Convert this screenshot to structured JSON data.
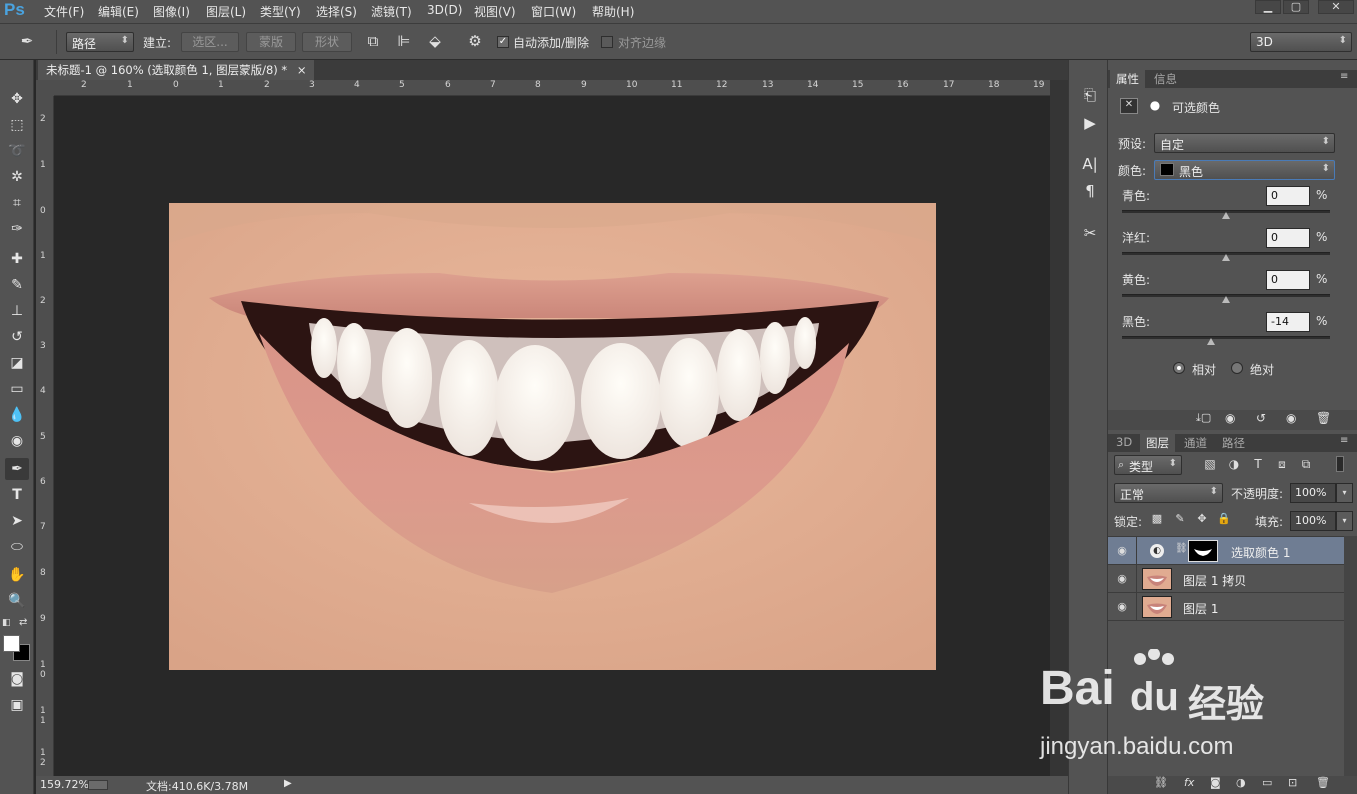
{
  "app": {
    "logo": "Ps"
  },
  "menu": [
    "文件(F)",
    "编辑(E)",
    "图像(I)",
    "图层(L)",
    "类型(Y)",
    "选择(S)",
    "滤镜(T)",
    "3D(D)",
    "视图(V)",
    "窗口(W)",
    "帮助(H)"
  ],
  "options": {
    "mode": "路径",
    "build_label": "建立:",
    "select_btn": "选区...",
    "mask_btn": "蒙版",
    "shape_btn": "形状",
    "auto_add": "自动添加/删除",
    "align_edges": "对齐边缘",
    "workspace": "3D"
  },
  "document": {
    "tab_title": "未标题-1 @ 160% (选取颜色 1, 图层蒙版/8) *",
    "close": "×"
  },
  "ruler": {
    "h_ticks": [
      "2",
      "1",
      "0",
      "1",
      "2",
      "3",
      "4",
      "5",
      "6",
      "7",
      "8",
      "9",
      "10",
      "11",
      "12",
      "13",
      "14",
      "15",
      "16",
      "17",
      "18",
      "19"
    ],
    "v_ticks": [
      "2",
      "1",
      "0",
      "1",
      "2",
      "3",
      "4",
      "5",
      "6",
      "7",
      "8",
      "9",
      "1 0",
      "1 1",
      "1 2"
    ]
  },
  "status": {
    "zoom": "159.72%",
    "doc": "文档:410.6K/3.78M"
  },
  "properties": {
    "tabs": [
      "属性",
      "信息"
    ],
    "title": "可选颜色",
    "preset_label": "预设:",
    "preset_value": "自定",
    "color_label": "颜色:",
    "color_value": "黑色",
    "sliders": [
      {
        "label": "青色:",
        "value": "0",
        "pct": "%",
        "pos": 0.5
      },
      {
        "label": "洋红:",
        "value": "0",
        "pct": "%",
        "pos": 0.5
      },
      {
        "label": "黄色:",
        "value": "0",
        "pct": "%",
        "pos": 0.5
      },
      {
        "label": "黑色:",
        "value": "-14",
        "pct": "%",
        "pos": 0.43
      }
    ],
    "relative": "相对",
    "absolute": "绝对"
  },
  "layers": {
    "tabs": [
      "3D",
      "图层",
      "通道",
      "路径"
    ],
    "filter": "类型",
    "blend": "正常",
    "opacity_label": "不透明度:",
    "opacity": "100%",
    "lock_label": "锁定:",
    "fill_label": "填充:",
    "fill": "100%",
    "items": [
      {
        "name": "选取颜色 1"
      },
      {
        "name": "图层 1 拷贝"
      },
      {
        "name": "图层 1"
      }
    ]
  },
  "watermark": {
    "brand": "Bai",
    "brand2": "du",
    "cn": "经验",
    "url": "jingyan.baidu.com"
  }
}
